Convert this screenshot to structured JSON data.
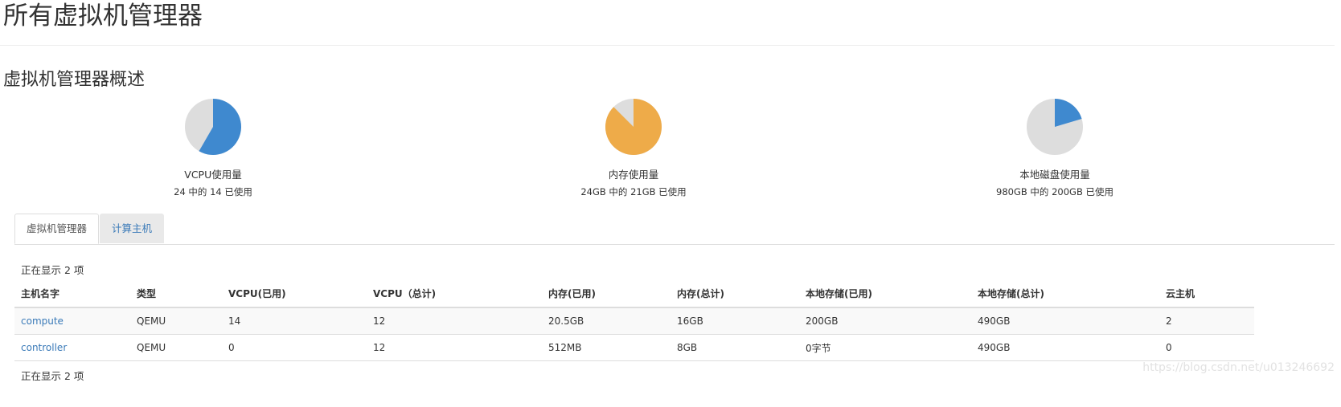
{
  "page": {
    "title": "所有虚拟机管理器",
    "section_title": "虚拟机管理器概述"
  },
  "quotas": [
    {
      "label": "VCPU使用量",
      "summary": "24 中的 14 已使用",
      "used": 14,
      "total": 24,
      "color": "#3f89cf"
    },
    {
      "label": "内存使用量",
      "summary": "24GB 中的 21GB 已使用",
      "used": 21,
      "total": 24,
      "color": "#eeab49"
    },
    {
      "label": "本地磁盘使用量",
      "summary": "980GB 中的 200GB 已使用",
      "used": 200,
      "total": 980,
      "color": "#3f89cf"
    }
  ],
  "pie_background": "#dddddd",
  "tabs": [
    {
      "label": "虚拟机管理器",
      "active": true
    },
    {
      "label": "计算主机",
      "active": false
    }
  ],
  "table": {
    "count_top": "正在显示 2 项",
    "count_bottom": "正在显示 2 项",
    "columns": [
      "主机名字",
      "类型",
      "VCPU(已用)",
      "VCPU（总计)",
      "内存(已用)",
      "内存(总计)",
      "本地存储(已用)",
      "本地存储(总计)",
      "云主机"
    ],
    "rows": [
      [
        "compute",
        "QEMU",
        "14",
        "12",
        "20.5GB",
        "16GB",
        "200GB",
        "490GB",
        "2"
      ],
      [
        "controller",
        "QEMU",
        "0",
        "12",
        "512MB",
        "8GB",
        "0字节",
        "490GB",
        "0"
      ]
    ]
  },
  "watermark": "https://blog.csdn.net/u013246692"
}
